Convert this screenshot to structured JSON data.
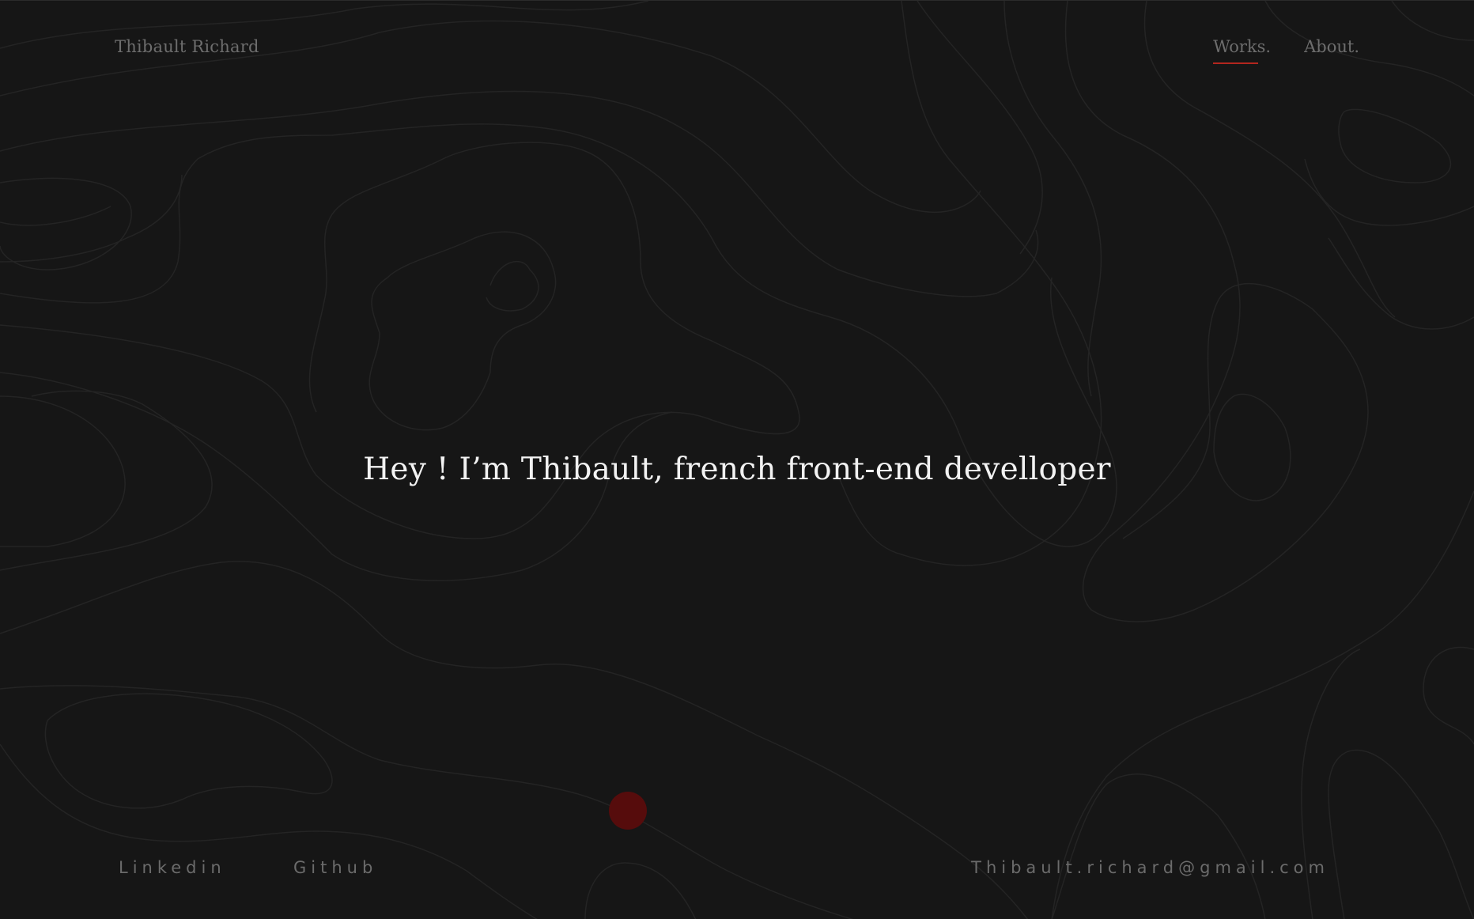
{
  "header": {
    "brand": "Thibault Richard",
    "nav": [
      {
        "label": "Works.",
        "active": true
      },
      {
        "label": "About.",
        "active": false
      }
    ]
  },
  "hero": {
    "headline": "Hey ! I’m Thibault, french front-end develloper"
  },
  "footer": {
    "linkedin": "Linkedin",
    "github": "Github",
    "email": "Thibault.richard@gmail.com"
  },
  "colors": {
    "background": "#161616",
    "accent": "#b3261e",
    "cursor": "#5a0c0c",
    "contour": "#242424",
    "muted_text": "#6d6d6d",
    "headline": "#f2f2f2"
  }
}
